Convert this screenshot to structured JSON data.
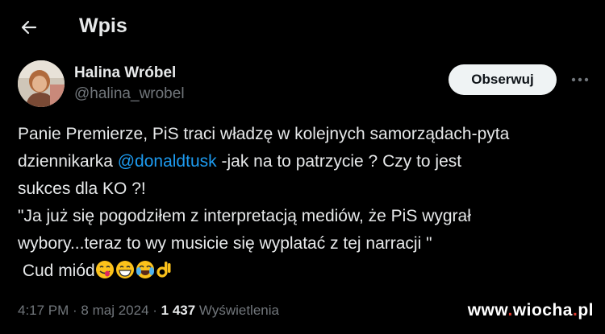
{
  "header": {
    "title": "Wpis",
    "back_icon": "arrow-left-icon"
  },
  "author": {
    "name": "Halina Wróbel",
    "handle": "@halina_wrobel",
    "avatar_icon": "user-avatar"
  },
  "actions": {
    "follow_label": "Obserwuj",
    "more_icon": "more-horizontal-icon"
  },
  "tweet": {
    "line1": "Panie Premierze, PiS traci władzę w kolejnych samorządach-pyta",
    "line2_before": "dziennikarka ",
    "line2_mention": "@donaldtusk",
    "line2_after": " -jak na to patrzycie ? Czy to jest",
    "line3": "sukces dla KO ?!",
    "line4": "\"Ja już się pogodziłem z interpretacją mediów, że PiS wygrał",
    "line5": "wybory...teraz to wy musicie się wyplatać z tej narracji \"",
    "line6": " Cud miód",
    "emojis": [
      "face-savoring-food",
      "grinning-face",
      "face-with-tears-of-joy",
      "ok-hand"
    ]
  },
  "meta": {
    "time": "4:17 PM",
    "sep1": " · ",
    "date": "8 maj 2024",
    "sep2": " · ",
    "views_count": "1 437",
    "views_label": " Wyświetlenia"
  },
  "watermark": {
    "prefix": "www",
    "dot1": ".",
    "name": "wiocha",
    "dot2": ".",
    "suffix": "pl"
  },
  "colors": {
    "background": "#000000",
    "text": "#e7e9ea",
    "muted": "#71767b",
    "link": "#1d9bf0",
    "button_bg": "#eff3f4"
  }
}
